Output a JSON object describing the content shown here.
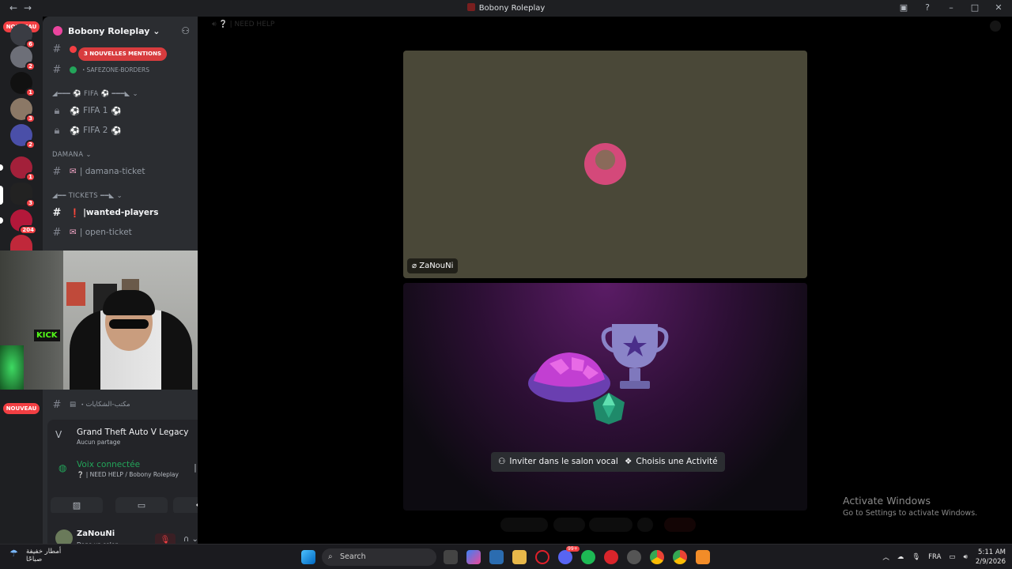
{
  "window": {
    "title": "Bobony Roleplay"
  },
  "rail": {
    "nouveau_top": "NOUVEAU",
    "nouveau_bottom": "NOUVEAU",
    "badges": [
      "6",
      "2",
      "1",
      "3",
      "2",
      "1",
      "3",
      "204"
    ]
  },
  "server": {
    "name": "Bobony Roleplay",
    "mentions_pill": "3 NOUVELLES MENTIONS",
    "channels": {
      "safezone": "SAFEZONE-BORDERS",
      "fifa_cat": "FIFA",
      "fifa1": "FIFA 1",
      "fifa2": "FIFA 2",
      "damana_cat": "DAMANA",
      "damana_ticket": "damana-ticket",
      "tickets_cat": "TICKETS",
      "wanted_players": "wanted-players",
      "open_ticket": "open-ticket",
      "complaints": "مكتب-الشكايات"
    }
  },
  "activity": {
    "game": "Grand Theft Auto V Legacy",
    "sub": "Aucun partage"
  },
  "voice": {
    "status": "Voix connectée",
    "channel": "❔ | NEED HELP / Bobony Roleplay"
  },
  "user": {
    "name": "ZaNouNi",
    "status": "Dans un salon ..."
  },
  "stage": {
    "header": "NEED HELP",
    "participant": "ZaNouNi",
    "invite_button": "Inviter dans le salon vocal",
    "activity_button": "Choisis une Activité"
  },
  "watermark": {
    "line1": "Activate Windows",
    "line2": "Go to Settings to activate Windows."
  },
  "taskbar": {
    "search_placeholder": "Search",
    "weather_line1": "أمطار خفيفة",
    "weather_line2": "صباحًا",
    "lang": "FRA",
    "time": "5:11 AM",
    "date": "2/9/2026",
    "discord_badge": "99+"
  },
  "colors": {
    "accent_red": "#f23f43",
    "voice_green": "#23a55a",
    "tile_bg": "#4a4838"
  }
}
